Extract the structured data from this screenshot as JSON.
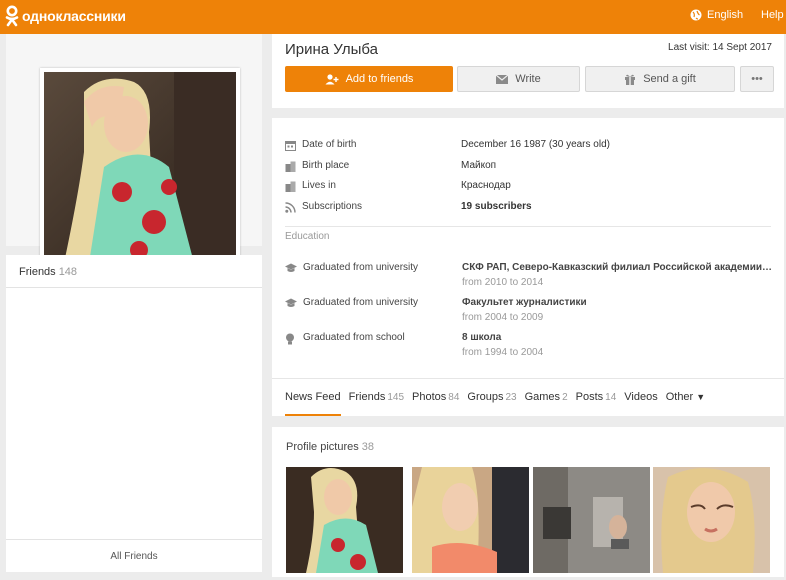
{
  "app": {
    "logo_text": "одноклассники",
    "language": "English",
    "help": "Help"
  },
  "profile": {
    "name": "Ирина Улыба",
    "last_visit": "Last visit: 14 Sept 2017",
    "buttons": {
      "add_friends": "Add to friends",
      "write": "Write",
      "send_gift": "Send a gift",
      "more": "•••"
    }
  },
  "friends": {
    "title": "Friends",
    "count": "148",
    "all_friends": "All Friends"
  },
  "info": [
    {
      "label": "Date of birth",
      "value": "December 16 1987 (30 years old)",
      "icon": "calendar-icon"
    },
    {
      "label": "Birth place",
      "value": "Майкоп",
      "icon": "building-icon"
    },
    {
      "label": "Lives in",
      "value": "Краснодар",
      "icon": "building-icon"
    },
    {
      "label": "Subscriptions",
      "value": "19 subscribers",
      "icon": "rss-icon"
    }
  ],
  "education": {
    "header": "Education",
    "items": [
      {
        "label": "Graduated from university",
        "institution": "СКФ РАП, Северо-Кавказский филиал Российской академии правосудия",
        "years": "from 2010 to 2014",
        "icon": "graduation-cap-icon"
      },
      {
        "label": "Graduated from university",
        "institution": "Факультет журналистики",
        "years": "from 2004 to 2009",
        "icon": "graduation-cap-icon"
      },
      {
        "label": "Graduated from school",
        "institution": "8 школа",
        "years": "from 1994 to 2004",
        "icon": "bulb-icon"
      }
    ]
  },
  "tabs": [
    {
      "label": "News Feed",
      "count": "",
      "active": true
    },
    {
      "label": "Friends",
      "count": "145"
    },
    {
      "label": "Photos",
      "count": "84"
    },
    {
      "label": "Groups",
      "count": "23"
    },
    {
      "label": "Games",
      "count": "2"
    },
    {
      "label": "Posts",
      "count": "14"
    },
    {
      "label": "Videos",
      "count": ""
    },
    {
      "label": "Other",
      "count": ""
    }
  ],
  "profile_pictures": {
    "title": "Profile pictures",
    "count": "38"
  },
  "colors": {
    "accent": "#ee8208",
    "background": "#ececec"
  }
}
